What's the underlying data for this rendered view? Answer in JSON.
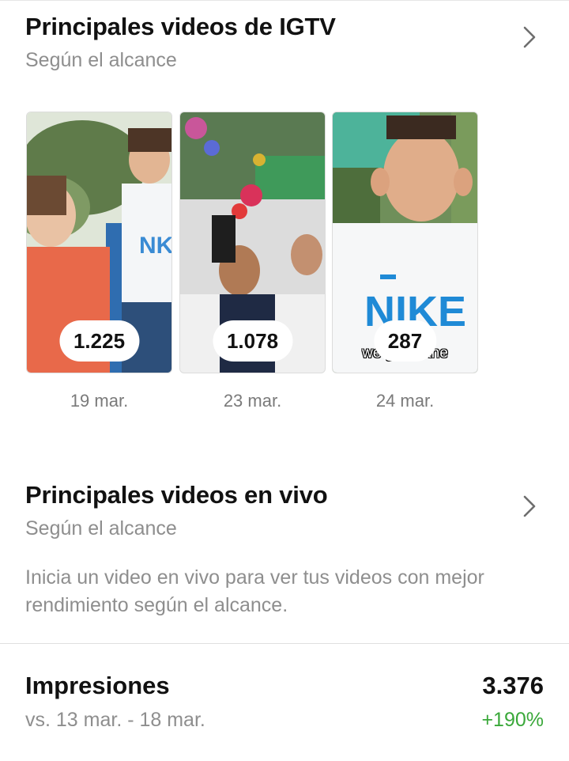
{
  "igtv": {
    "title": "Principales videos de IGTV",
    "subtitle": "Según el alcance",
    "videos": [
      {
        "count": "1.225",
        "date": "19 mar.",
        "caption": ""
      },
      {
        "count": "1.078",
        "date": "23 mar.",
        "caption": ""
      },
      {
        "count": "287",
        "date": "24 mar.",
        "caption": "we ga          do the"
      }
    ]
  },
  "live": {
    "title": "Principales videos en vivo",
    "subtitle": "Según el alcance",
    "empty_text": "Inicia un video en vivo para ver tus videos con mejor rendimiento según el alcance."
  },
  "impressions": {
    "label": "Impresiones",
    "value": "3.376",
    "comparison": "vs. 13 mar. - 18 mar.",
    "change": "+190%",
    "change_color": "#3aa83a"
  },
  "icons": {
    "chevron": "chevron-right-icon"
  }
}
